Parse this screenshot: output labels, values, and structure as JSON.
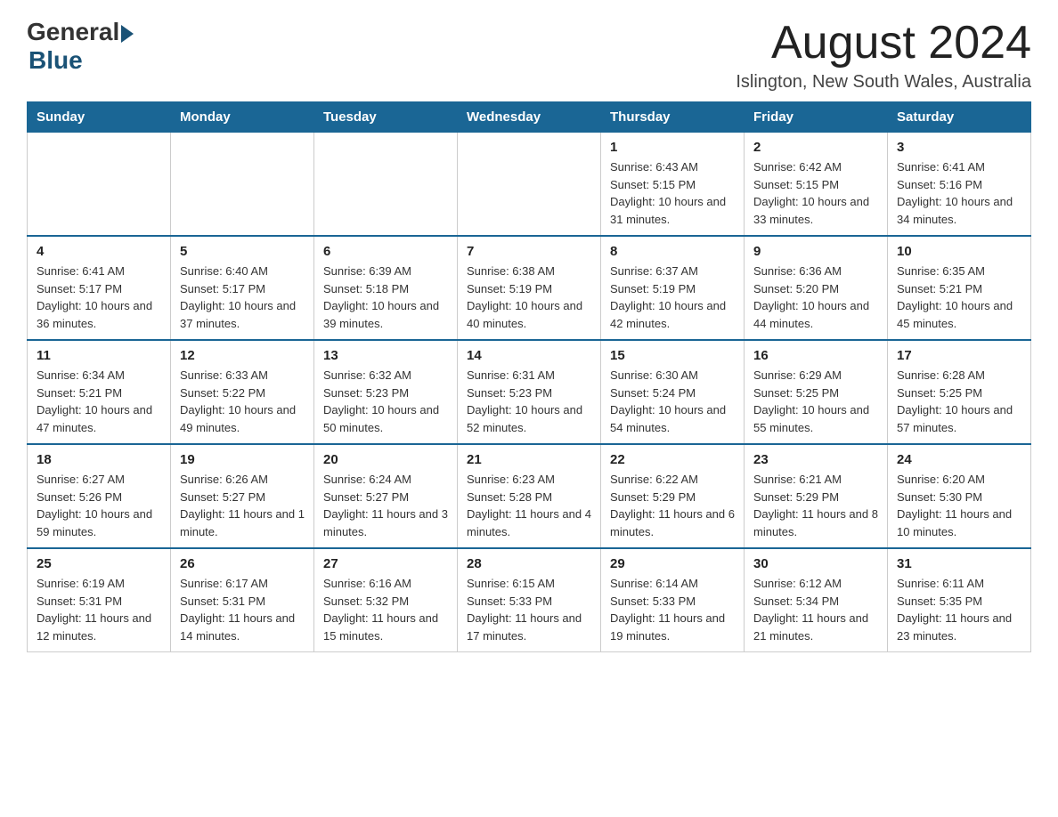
{
  "logo": {
    "general": "General",
    "blue": "Blue"
  },
  "title": "August 2024",
  "location": "Islington, New South Wales, Australia",
  "weekdays": [
    "Sunday",
    "Monday",
    "Tuesday",
    "Wednesday",
    "Thursday",
    "Friday",
    "Saturday"
  ],
  "weeks": [
    [
      {
        "day": "",
        "info": ""
      },
      {
        "day": "",
        "info": ""
      },
      {
        "day": "",
        "info": ""
      },
      {
        "day": "",
        "info": ""
      },
      {
        "day": "1",
        "info": "Sunrise: 6:43 AM\nSunset: 5:15 PM\nDaylight: 10 hours and 31 minutes."
      },
      {
        "day": "2",
        "info": "Sunrise: 6:42 AM\nSunset: 5:15 PM\nDaylight: 10 hours and 33 minutes."
      },
      {
        "day": "3",
        "info": "Sunrise: 6:41 AM\nSunset: 5:16 PM\nDaylight: 10 hours and 34 minutes."
      }
    ],
    [
      {
        "day": "4",
        "info": "Sunrise: 6:41 AM\nSunset: 5:17 PM\nDaylight: 10 hours and 36 minutes."
      },
      {
        "day": "5",
        "info": "Sunrise: 6:40 AM\nSunset: 5:17 PM\nDaylight: 10 hours and 37 minutes."
      },
      {
        "day": "6",
        "info": "Sunrise: 6:39 AM\nSunset: 5:18 PM\nDaylight: 10 hours and 39 minutes."
      },
      {
        "day": "7",
        "info": "Sunrise: 6:38 AM\nSunset: 5:19 PM\nDaylight: 10 hours and 40 minutes."
      },
      {
        "day": "8",
        "info": "Sunrise: 6:37 AM\nSunset: 5:19 PM\nDaylight: 10 hours and 42 minutes."
      },
      {
        "day": "9",
        "info": "Sunrise: 6:36 AM\nSunset: 5:20 PM\nDaylight: 10 hours and 44 minutes."
      },
      {
        "day": "10",
        "info": "Sunrise: 6:35 AM\nSunset: 5:21 PM\nDaylight: 10 hours and 45 minutes."
      }
    ],
    [
      {
        "day": "11",
        "info": "Sunrise: 6:34 AM\nSunset: 5:21 PM\nDaylight: 10 hours and 47 minutes."
      },
      {
        "day": "12",
        "info": "Sunrise: 6:33 AM\nSunset: 5:22 PM\nDaylight: 10 hours and 49 minutes."
      },
      {
        "day": "13",
        "info": "Sunrise: 6:32 AM\nSunset: 5:23 PM\nDaylight: 10 hours and 50 minutes."
      },
      {
        "day": "14",
        "info": "Sunrise: 6:31 AM\nSunset: 5:23 PM\nDaylight: 10 hours and 52 minutes."
      },
      {
        "day": "15",
        "info": "Sunrise: 6:30 AM\nSunset: 5:24 PM\nDaylight: 10 hours and 54 minutes."
      },
      {
        "day": "16",
        "info": "Sunrise: 6:29 AM\nSunset: 5:25 PM\nDaylight: 10 hours and 55 minutes."
      },
      {
        "day": "17",
        "info": "Sunrise: 6:28 AM\nSunset: 5:25 PM\nDaylight: 10 hours and 57 minutes."
      }
    ],
    [
      {
        "day": "18",
        "info": "Sunrise: 6:27 AM\nSunset: 5:26 PM\nDaylight: 10 hours and 59 minutes."
      },
      {
        "day": "19",
        "info": "Sunrise: 6:26 AM\nSunset: 5:27 PM\nDaylight: 11 hours and 1 minute."
      },
      {
        "day": "20",
        "info": "Sunrise: 6:24 AM\nSunset: 5:27 PM\nDaylight: 11 hours and 3 minutes."
      },
      {
        "day": "21",
        "info": "Sunrise: 6:23 AM\nSunset: 5:28 PM\nDaylight: 11 hours and 4 minutes."
      },
      {
        "day": "22",
        "info": "Sunrise: 6:22 AM\nSunset: 5:29 PM\nDaylight: 11 hours and 6 minutes."
      },
      {
        "day": "23",
        "info": "Sunrise: 6:21 AM\nSunset: 5:29 PM\nDaylight: 11 hours and 8 minutes."
      },
      {
        "day": "24",
        "info": "Sunrise: 6:20 AM\nSunset: 5:30 PM\nDaylight: 11 hours and 10 minutes."
      }
    ],
    [
      {
        "day": "25",
        "info": "Sunrise: 6:19 AM\nSunset: 5:31 PM\nDaylight: 11 hours and 12 minutes."
      },
      {
        "day": "26",
        "info": "Sunrise: 6:17 AM\nSunset: 5:31 PM\nDaylight: 11 hours and 14 minutes."
      },
      {
        "day": "27",
        "info": "Sunrise: 6:16 AM\nSunset: 5:32 PM\nDaylight: 11 hours and 15 minutes."
      },
      {
        "day": "28",
        "info": "Sunrise: 6:15 AM\nSunset: 5:33 PM\nDaylight: 11 hours and 17 minutes."
      },
      {
        "day": "29",
        "info": "Sunrise: 6:14 AM\nSunset: 5:33 PM\nDaylight: 11 hours and 19 minutes."
      },
      {
        "day": "30",
        "info": "Sunrise: 6:12 AM\nSunset: 5:34 PM\nDaylight: 11 hours and 21 minutes."
      },
      {
        "day": "31",
        "info": "Sunrise: 6:11 AM\nSunset: 5:35 PM\nDaylight: 11 hours and 23 minutes."
      }
    ]
  ]
}
